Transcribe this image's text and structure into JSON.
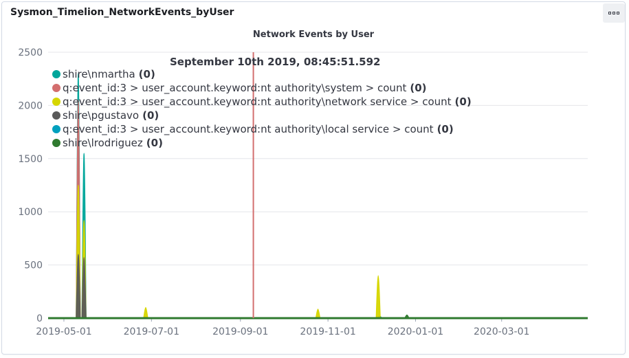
{
  "panel": {
    "title": "Sysmon_Timelion_NetworkEvents_byUser"
  },
  "hover_time": "September 10th 2019, 08:45:51.592",
  "chart_data": {
    "type": "line",
    "title": "Network Events by User",
    "xlabel": "",
    "ylabel": "",
    "ylim": [
      0,
      2500
    ],
    "y_ticks": [
      0,
      500,
      1000,
      1500,
      2000,
      2500
    ],
    "y_tick_labels": [
      "0",
      "500",
      "1000",
      "1500",
      "2000",
      "2500"
    ],
    "x_range": [
      "2019-04-20",
      "2020-04-30"
    ],
    "x_ticks": [
      "2019-05-01",
      "2019-07-01",
      "2019-09-01",
      "2019-11-01",
      "2020-01-01",
      "2020-03-01"
    ],
    "x_tick_labels": [
      "2019-05-01",
      "2019-07-01",
      "2019-09-01",
      "2019-11-01",
      "2020-01-01",
      "2020-03-01"
    ],
    "grid": true,
    "crosshair_date": "2019-09-10",
    "series": [
      {
        "name": "shire\\nmartha",
        "count": "(0)",
        "color": "#00a69b",
        "peaks": [
          [
            "2019-05-11",
            2300
          ],
          [
            "2019-05-15",
            1550
          ],
          [
            "2019-12-07",
            20
          ]
        ]
      },
      {
        "name": "q:event_id:3 > user_account.keyword:nt authority\\system > count",
        "count": "(0)",
        "color": "#d36e6e",
        "peaks": [
          [
            "2019-05-11",
            2050
          ]
        ]
      },
      {
        "name": "q:event_id:3 > user_account.keyword:nt authority\\network service > count",
        "count": "(0)",
        "color": "#d6d600",
        "peaks": [
          [
            "2019-05-11",
            1250
          ],
          [
            "2019-05-15",
            920
          ],
          [
            "2019-06-27",
            100
          ],
          [
            "2019-10-25",
            85
          ],
          [
            "2019-12-06",
            400
          ]
        ]
      },
      {
        "name": "shire\\pgustavo",
        "count": "(0)",
        "color": "#5a5a5a",
        "peaks": [
          [
            "2019-05-11",
            600
          ],
          [
            "2019-05-15",
            570
          ]
        ]
      },
      {
        "name": "q:event_id:3 > user_account.keyword:nt authority\\local service > count",
        "count": "(0)",
        "color": "#00a0be",
        "peaks": []
      },
      {
        "name": "shire\\lrodriguez",
        "count": "(0)",
        "color": "#2f7a2f",
        "peaks": [
          [
            "2019-12-26",
            30
          ]
        ]
      }
    ]
  }
}
